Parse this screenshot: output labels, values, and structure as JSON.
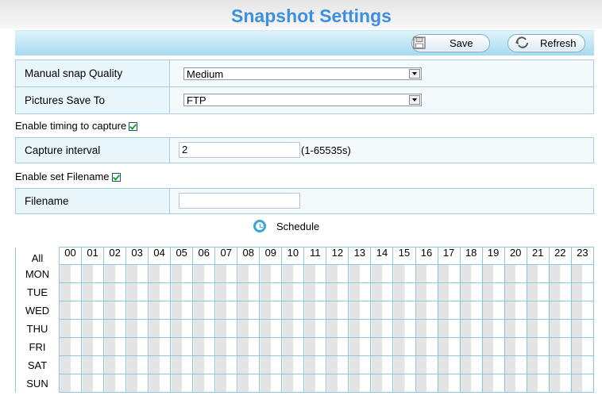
{
  "page": {
    "title": "Snapshot Settings"
  },
  "toolbar": {
    "save_label": "Save",
    "refresh_label": "Refresh"
  },
  "settings": {
    "manual_snap_quality_label": "Manual snap Quality",
    "manual_snap_quality_value": "Medium",
    "pictures_save_to_label": "Pictures Save To",
    "pictures_save_to_value": "FTP",
    "enable_timing_label": "Enable timing to capture",
    "enable_timing_checked": true,
    "capture_interval_label": "Capture interval",
    "capture_interval_value": "2",
    "capture_interval_hint": "(1-65535s)",
    "enable_filename_label": "Enable set Filename",
    "enable_filename_checked": true,
    "filename_label": "Filename",
    "filename_value": ""
  },
  "schedule": {
    "label": "Schedule",
    "all_label": "All",
    "hours": [
      "00",
      "01",
      "02",
      "03",
      "04",
      "05",
      "06",
      "07",
      "08",
      "09",
      "10",
      "11",
      "12",
      "13",
      "14",
      "15",
      "16",
      "17",
      "18",
      "19",
      "20",
      "21",
      "22",
      "23"
    ],
    "days": [
      "MON",
      "TUE",
      "WED",
      "THU",
      "FRI",
      "SAT",
      "SUN"
    ]
  },
  "colors": {
    "title": "#3d8fe0",
    "toolbar": "#a7daf0",
    "grid_line": "#8ec6dd",
    "shaded_cell": "#e4e4e4"
  }
}
